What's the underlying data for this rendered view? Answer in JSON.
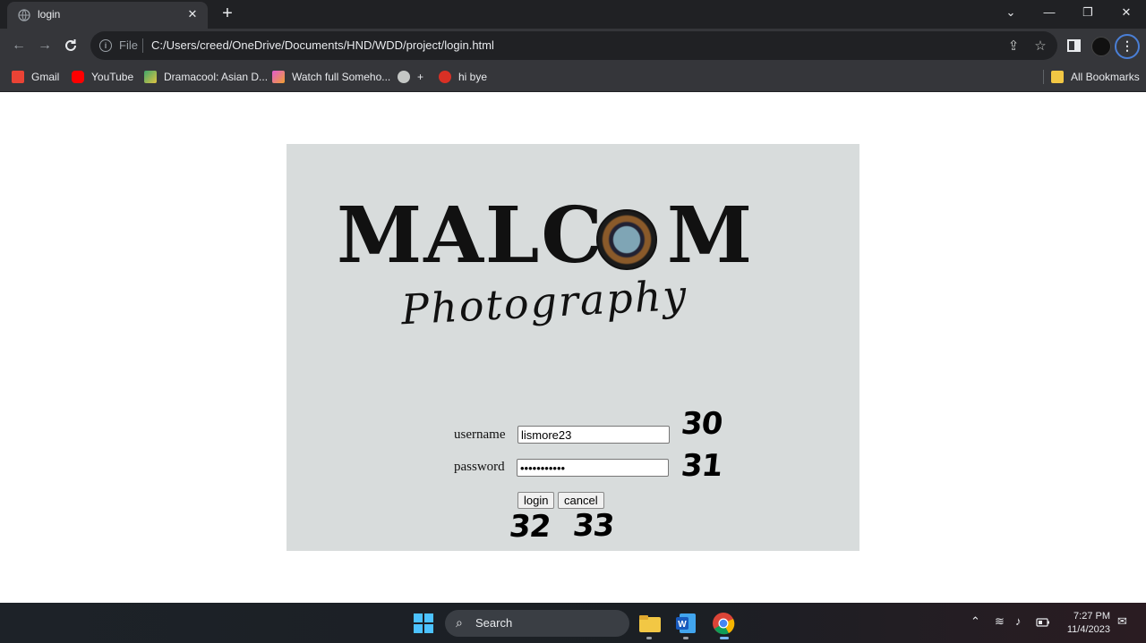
{
  "browser": {
    "tab_title": "login",
    "tab_close": "✕",
    "new_tab": "+",
    "window_controls": {
      "minimize": "—",
      "restore": "❐",
      "close": "✕",
      "tab_search": "⌄"
    },
    "file_label": "File",
    "url": "C:/Users/creed/OneDrive/Documents/HND/WDD/project/login.html",
    "bookmarks": [
      {
        "label": "Gmail",
        "icon": "gmail-icon",
        "color": "#ea4335"
      },
      {
        "label": "YouTube",
        "icon": "youtube-icon",
        "color": "#ff0000"
      },
      {
        "label": "Dramacool: Asian D...",
        "icon": "dramacool-icon",
        "color": "#3fa66b"
      },
      {
        "label": "Watch full Someho...",
        "icon": "kissasian-icon",
        "color": "#e05bd0"
      },
      {
        "label": "+",
        "icon": "globe-icon",
        "color": "#c4c7c5"
      },
      {
        "label": "hi bye",
        "icon": "m-icon",
        "color": "#d93025"
      }
    ],
    "all_bookmarks": "All Bookmarks"
  },
  "page": {
    "logo_main": "MALC",
    "logo_end": "M",
    "logo_sub": "Photography",
    "username_label": "username",
    "username_value": "lismore23",
    "password_label": "password",
    "password_value": "•••••••••••",
    "login_button": "login",
    "cancel_button": "cancel",
    "annotations": [
      "30",
      "31",
      "32",
      "33"
    ]
  },
  "taskbar": {
    "search_label": "Search",
    "time": "7:27 PM",
    "date": "11/4/2023"
  },
  "colors": {
    "panel_bg": "#d8dcdc",
    "chrome_dark": "#202124",
    "chrome_toolbar": "#35363a",
    "accent_blue": "#4a7fd6"
  }
}
